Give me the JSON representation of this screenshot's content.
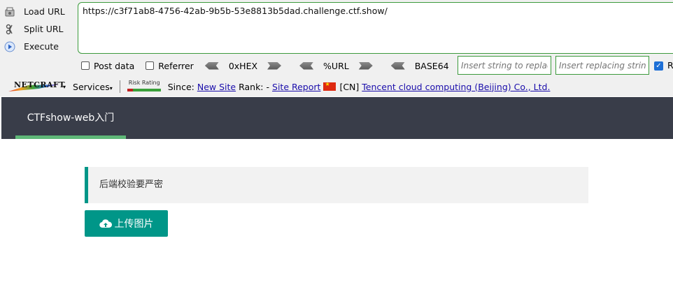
{
  "hackbar": {
    "actions": [
      {
        "label": "Load URL",
        "icon": "load-url-icon"
      },
      {
        "label": "Split URL",
        "icon": "split-url-icon"
      },
      {
        "label": "Execute",
        "icon": "execute-icon"
      }
    ],
    "url": "https://c3f71ab8-4756-42ab-9b5b-53e8813b5dad.challenge.ctf.show/",
    "options": {
      "post_data": "Post data",
      "referrer": "Referrer",
      "hex": "0xHEX",
      "url_enc": "%URL",
      "base64": "BASE64"
    },
    "replace_placeholder": "Insert string to replace",
    "replacing_placeholder": "Insert replacing string",
    "replace_checked": true,
    "replace_label": "R"
  },
  "netcraft": {
    "logo_text": "NETCRAFT",
    "services": "Services",
    "risk_label": "Risk Rating",
    "since_label": "Since:",
    "since_value": "New Site",
    "rank_label": "Rank:",
    "rank_value": "-",
    "site_report": "Site Report",
    "country": "[CN]",
    "host": "Tencent cloud computing (Beijing) Co., Ltd."
  },
  "page": {
    "nav_title": "CTFshow-web入门",
    "notice": "后端校验要严密",
    "upload_label": "上传图片"
  },
  "colors": {
    "accent": "#009688",
    "nav_bg": "#393d49",
    "nav_underline": "#5fb878",
    "hackbar_border": "#3c9a3c"
  }
}
